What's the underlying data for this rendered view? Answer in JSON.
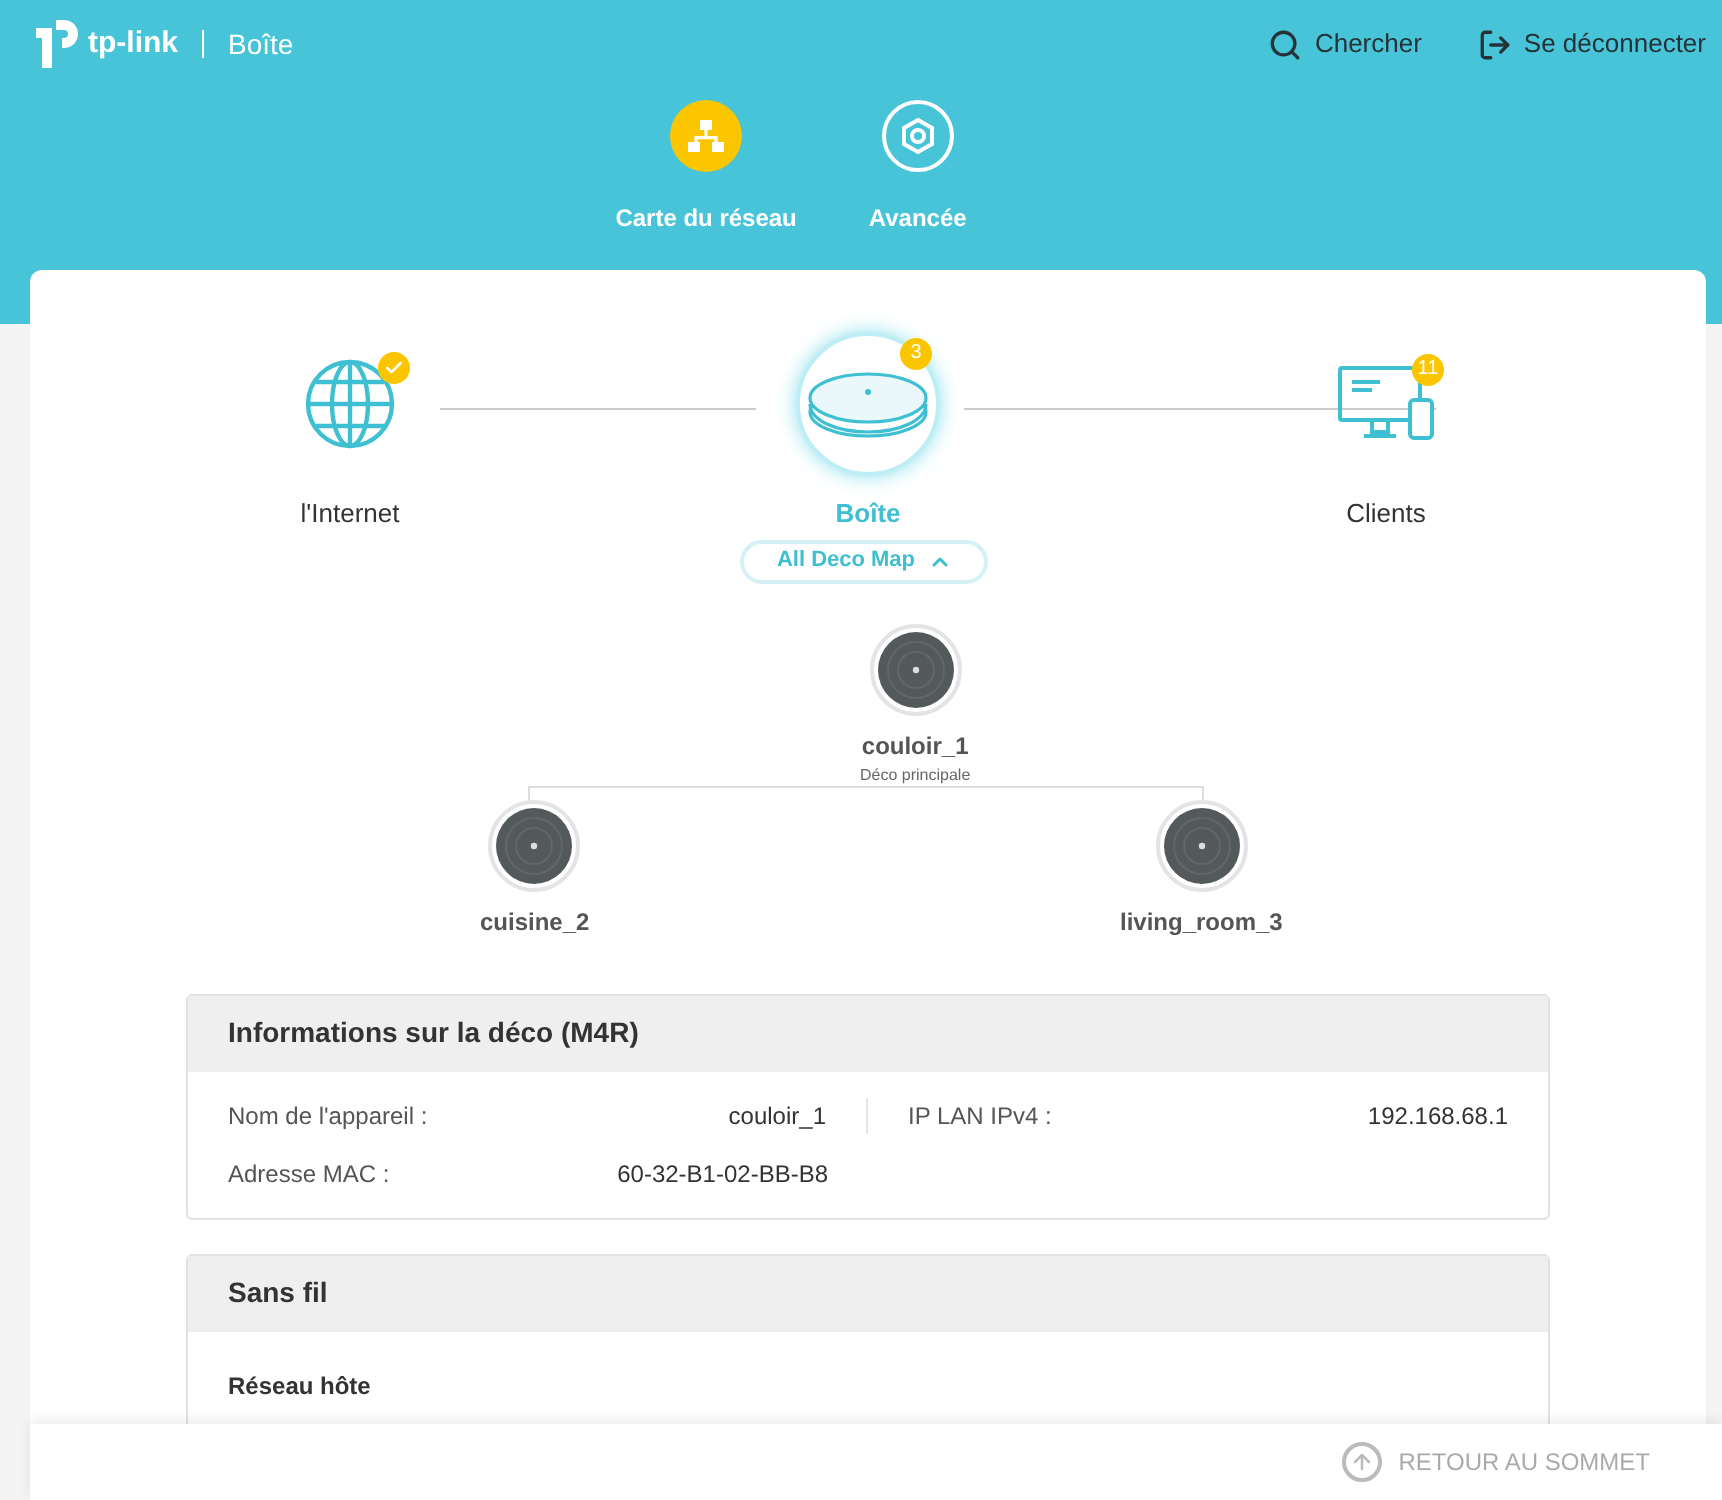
{
  "header": {
    "logo": "tp-link",
    "device": "Boîte",
    "actions": [
      {
        "label": "Chercher",
        "kind": "search"
      },
      {
        "label": "Se déconnecter",
        "kind": "logout"
      }
    ]
  },
  "nav": [
    {
      "label": "Carte du réseau",
      "kind": "map",
      "selected": true
    },
    {
      "label": "Avancée",
      "kind": "advanced",
      "selected": false
    }
  ],
  "topology": [
    {
      "label": "l'Internet",
      "kind": "internet",
      "connected": true
    },
    {
      "label": "Boîte",
      "kind": "deco",
      "badge": "3"
    },
    {
      "label": "Clients",
      "kind": "clients",
      "badge": "11"
    }
  ],
  "deco_map_button": {
    "label": "All Deco Map",
    "expanded": true
  },
  "mesh": {
    "name": "couloir_1",
    "role": "Déco principale",
    "children": [
      {
        "name": "cuisine_2"
      },
      {
        "name": "living_room_3"
      }
    ]
  },
  "info_panel": {
    "title": "Informations sur la déco (M4R)",
    "fields": [
      {
        "label": "Nom de l'appareil :",
        "value": "couloir_1"
      },
      {
        "label": "IP LAN IPv4 :",
        "value": "192.168.68.1"
      },
      {
        "label": "Adresse MAC :",
        "value": "60-32-B1-02-BB-B8"
      }
    ]
  },
  "wireless_panel": {
    "title": "Sans fil",
    "subtitle": "Réseau hôte"
  },
  "footer": {
    "back_to_top": "RETOUR AU SOMMET"
  }
}
